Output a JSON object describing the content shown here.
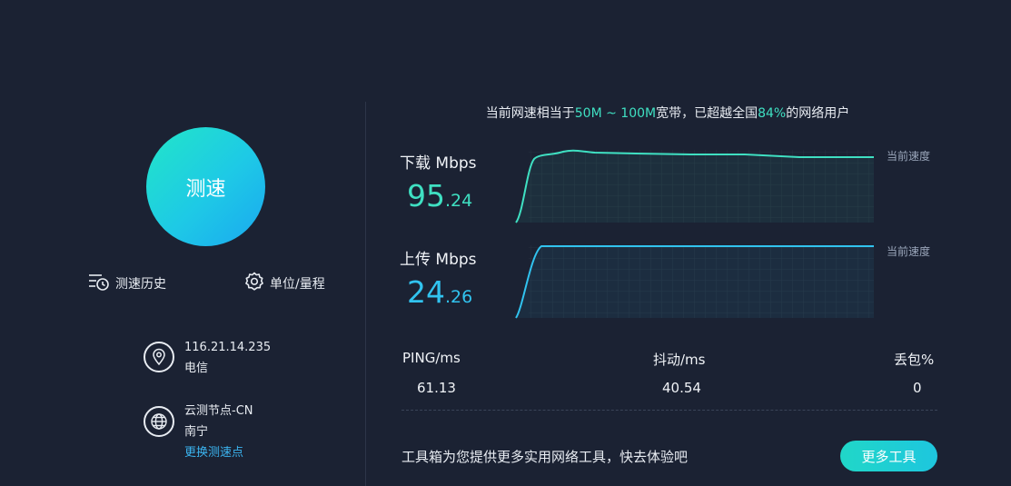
{
  "left": {
    "speed_button": "测速",
    "history_label": "测速历史",
    "units_label": "单位/量程",
    "ip": "116.21.14.235",
    "isp": "电信",
    "node_name": "云测节点-CN",
    "node_city": "南宁",
    "change_node": "更换测速点"
  },
  "headline": {
    "prefix": "当前网速相当于",
    "range": "50M ~ 100M",
    "middle": "宽带，已超越全国",
    "percent": "84%",
    "suffix": "的网络用户"
  },
  "download": {
    "label": "下载 Mbps",
    "value_int": "95",
    "value_dec": ".24",
    "current_speed_label": "当前速度",
    "color": "#3fe0c2"
  },
  "upload": {
    "label": "上传 Mbps",
    "value_int": "24",
    "value_dec": ".26",
    "current_speed_label": "当前速度",
    "color": "#31c3ef"
  },
  "stats": {
    "ping_label": "PING/ms",
    "ping_value": "61.13",
    "jitter_label": "抖动/ms",
    "jitter_value": "40.54",
    "loss_label": "丢包%",
    "loss_value": "0"
  },
  "footer": {
    "promo": "工具箱为您提供更多实用网络工具，快去体验吧",
    "more_tools": "更多工具"
  }
}
